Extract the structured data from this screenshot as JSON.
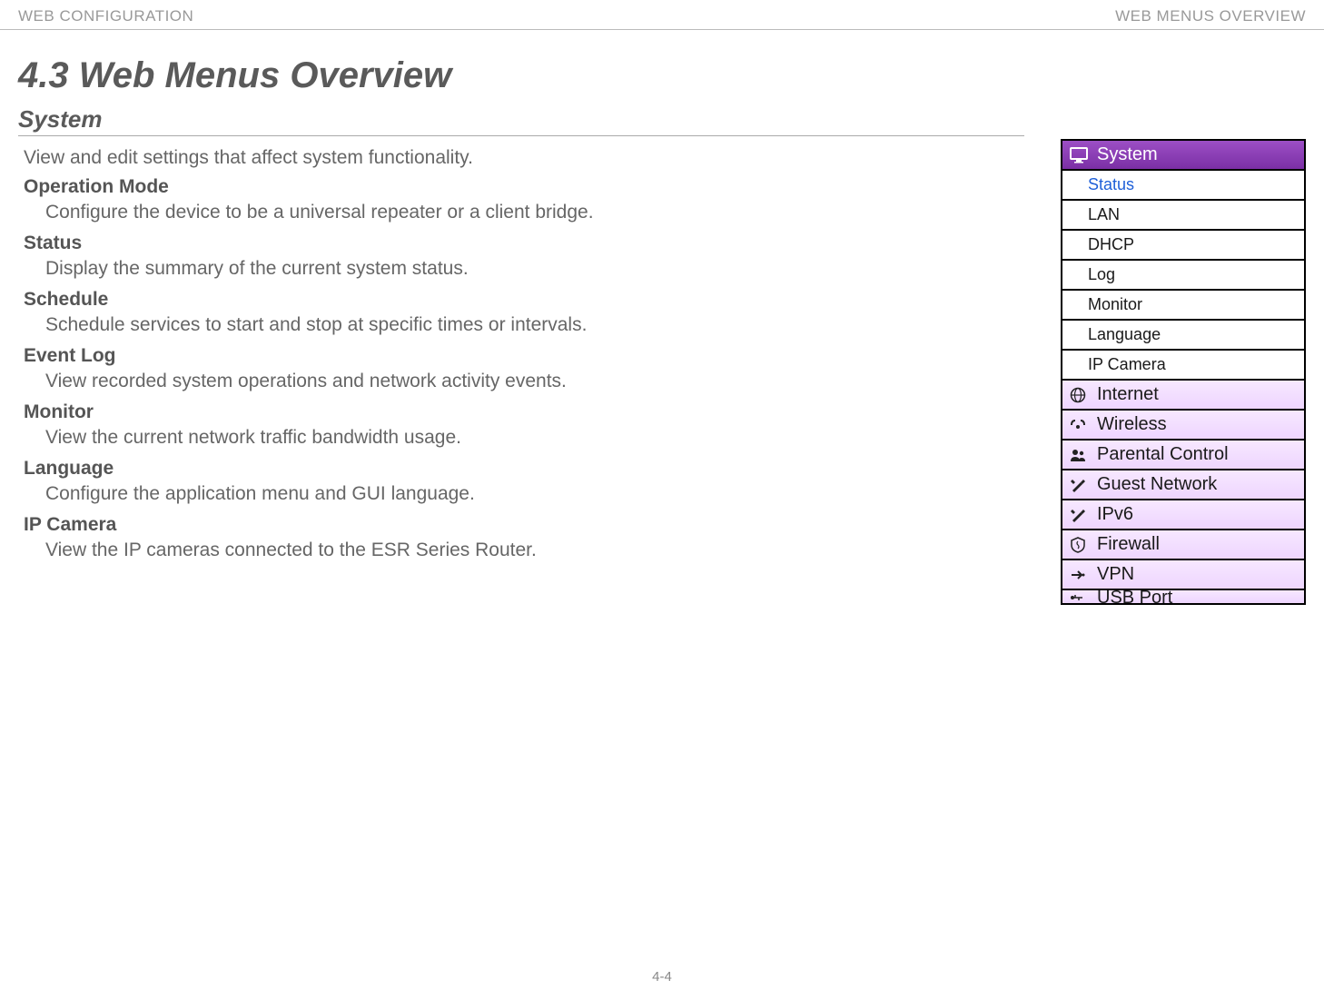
{
  "header": {
    "left": "WEB CONFIGURATION",
    "right": "WEB MENUS OVERVIEW"
  },
  "title": "4.3 Web Menus Overview",
  "section_heading": "System",
  "intro": "View and edit settings that affect system functionality.",
  "items": [
    {
      "title": "Operation Mode",
      "desc": "Configure the device to be a universal repeater or a client bridge."
    },
    {
      "title": "Status",
      "desc": "Display the summary of the current system status."
    },
    {
      "title": "Schedule",
      "desc": "Schedule services to start and stop at specific times or intervals."
    },
    {
      "title": "Event Log",
      "desc": "View recorded system operations and network activity events."
    },
    {
      "title": "Monitor",
      "desc": "View the current network traffic bandwidth usage."
    },
    {
      "title": "Language",
      "desc": "Configure the application menu and GUI language."
    },
    {
      "title": "IP Camera",
      "desc": "View the IP cameras connected to the ESR Series Router."
    }
  ],
  "menu": {
    "header": "System",
    "sub": [
      "Status",
      "LAN",
      "DHCP",
      "Log",
      "Monitor",
      "Language",
      "IP Camera"
    ],
    "rows": [
      "Internet",
      "Wireless",
      "Parental Control",
      "Guest Network",
      "IPv6",
      "Firewall",
      "VPN",
      "USB Port"
    ]
  },
  "page_number": "4-4"
}
